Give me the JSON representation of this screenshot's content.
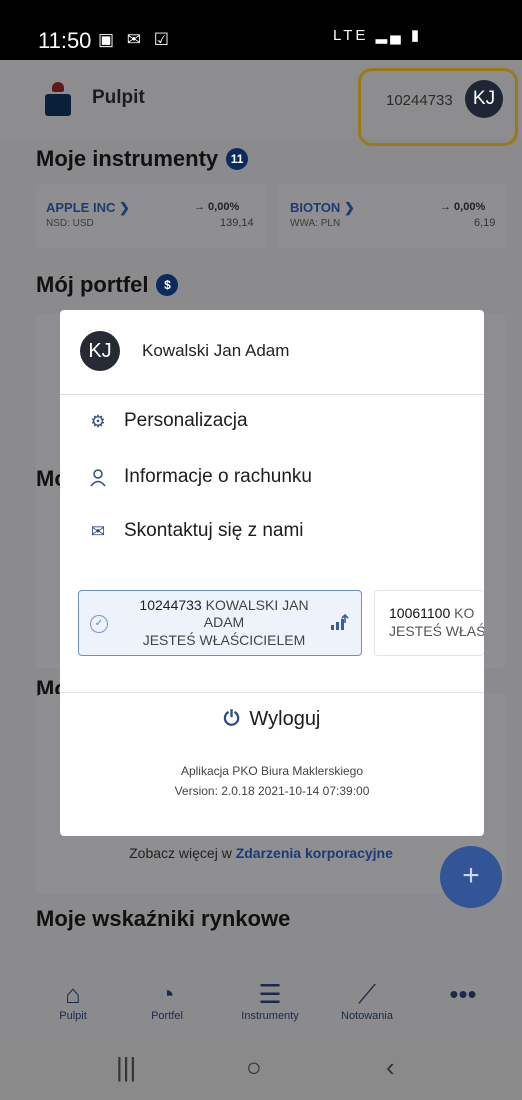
{
  "status_bar": {
    "time": "11:50",
    "left_icons": "▣ ✉ ☑",
    "right_icons": "LTE ▂▄ ▮"
  },
  "header": {
    "title": "Pulpit",
    "account_number": "10244733",
    "avatar_initials": "KJ"
  },
  "sections": {
    "instruments_title": "Moje instrumenty",
    "instruments_count": "11",
    "portfolio_title": "Mój portfel",
    "portfolio_badge": "$",
    "partial_title_1": "Mo",
    "partial_title_2": "Mo",
    "indicators_title": "Moje wskaźniki rynkowe"
  },
  "instruments": [
    {
      "name": "APPLE INC",
      "arrow": "❯",
      "market": "NSD: USD",
      "change": "→ 0,00%",
      "price": "139,14"
    },
    {
      "name": "BIOTON",
      "arrow": "❯",
      "market": "WWA: PLN",
      "change": "→ 0,00%",
      "price": "6,19"
    }
  ],
  "more_link": {
    "prefix": "Zobacz więcej w",
    "target": "Zdarzenia korporacyjne"
  },
  "fab_label": "+",
  "bottom_nav": [
    {
      "icon": "⌂",
      "label": "Pulpit"
    },
    {
      "icon": "◔",
      "label": "Portfel"
    },
    {
      "icon": "☰",
      "label": "Instrumenty"
    },
    {
      "icon": "⟋",
      "label": "Notowania"
    },
    {
      "icon": "•••",
      "label": ""
    }
  ],
  "system_nav": {
    "recents": "|||",
    "home": "○",
    "back": "‹"
  },
  "modal": {
    "avatar_initials": "KJ",
    "user_name": "Kowalski Jan Adam",
    "menu": [
      {
        "icon": "⚙",
        "label": "Personalizacja"
      },
      {
        "icon": "👤",
        "label": "Informacje o rachunku"
      },
      {
        "icon": "✉",
        "label": "Skontaktuj się z nami"
      }
    ],
    "accounts": [
      {
        "number": "10244733",
        "name_line_a": "KOWALSKI JAN",
        "name_line_b": "ADAM",
        "role": "JESTEŚ WŁAŚCICIELEM"
      },
      {
        "number": "10061100",
        "name_partial": "KO",
        "role_partial": "JESTEŚ WŁAŚC"
      }
    ],
    "logout_label": "Wyloguj",
    "footer_line1": "Aplikacja PKO Biura Maklerskiego",
    "footer_line2": "Version: 2.0.18 2021-10-14 07:39:00"
  }
}
